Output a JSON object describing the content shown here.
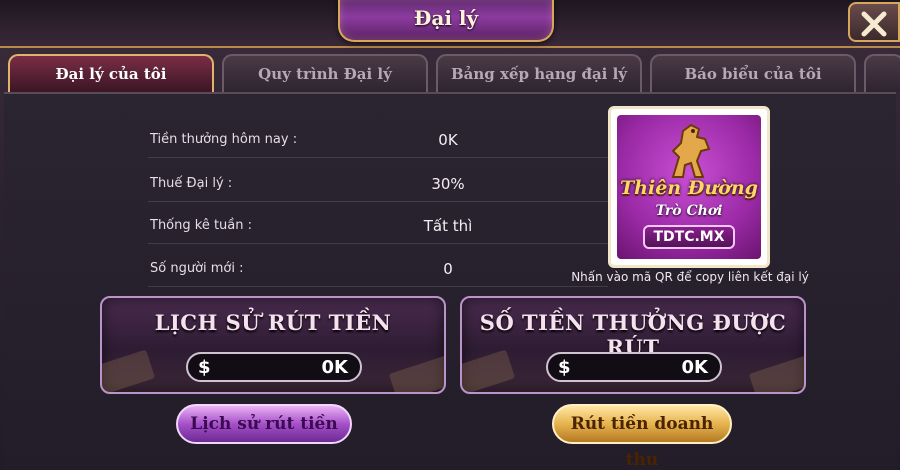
{
  "header": {
    "title": "Đại lý",
    "close_symbol": "✕"
  },
  "tabs": [
    {
      "label": "Đại lý của tôi",
      "active": true
    },
    {
      "label": "Quy trình Đại lý",
      "active": false
    },
    {
      "label": "Bảng xếp hạng đại lý",
      "active": false
    },
    {
      "label": "Báo biểu của tôi",
      "active": false
    }
  ],
  "stats": [
    {
      "label": "Tiền thưởng hôm nay :",
      "value": "0K"
    },
    {
      "label": "Thuế Đại lý :",
      "value": "30%"
    },
    {
      "label": "Thống kê tuần :",
      "value": "Tất thì"
    },
    {
      "label": "Số người mới :",
      "value": "0"
    }
  ],
  "qr": {
    "logo_title": "Thiên Đường",
    "logo_subtitle": "Trò Chơi",
    "logo_domain": "TDTC.MX",
    "hint": "Nhấn vào mã QR để copy liên kết đại lý"
  },
  "cards": [
    {
      "title": "LỊCH SỬ RÚT TIỀN",
      "currency": "$",
      "amount": "0K"
    },
    {
      "title": "SỐ TIỀN THƯỞNG ĐƯỢC RÚT",
      "currency": "$",
      "amount": "0K"
    }
  ],
  "buttons": {
    "history": "Lịch sử rút tiền",
    "withdraw": "Rút tiền doanh thu"
  },
  "colors": {
    "gold_accent": "#d7a659",
    "active_tab": "#7a2d45",
    "logo_purple": "#9b2aa6"
  }
}
